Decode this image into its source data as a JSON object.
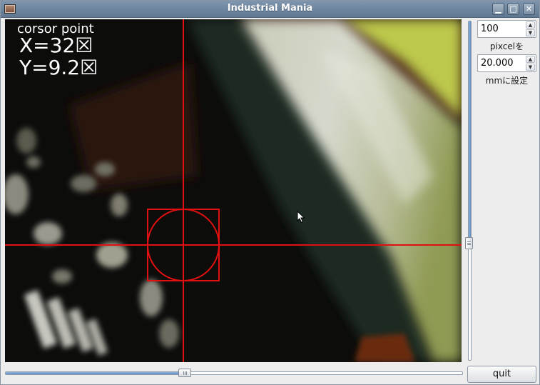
{
  "window": {
    "title": "Industrial Mania",
    "minimize_glyph": "▁",
    "maximize_glyph": "□",
    "close_glyph": "✕"
  },
  "camera": {
    "label": "corsor point",
    "x_readout": "X=32☒",
    "y_readout": "Y=9.2☒",
    "overlay_color": "#e01010"
  },
  "controls": {
    "pixel_value": "100",
    "pixel_label": "pixcelを",
    "mm_value": "20.000",
    "mm_label": "mmに設定",
    "quit_label": "quit",
    "spin_up_glyph": "▲",
    "spin_down_glyph": "▼",
    "vertical_slider_position": 0.66,
    "horizontal_slider_position": 0.39
  },
  "icons": {
    "app": "app-icon",
    "cursor": "mouse-pointer-icon"
  }
}
